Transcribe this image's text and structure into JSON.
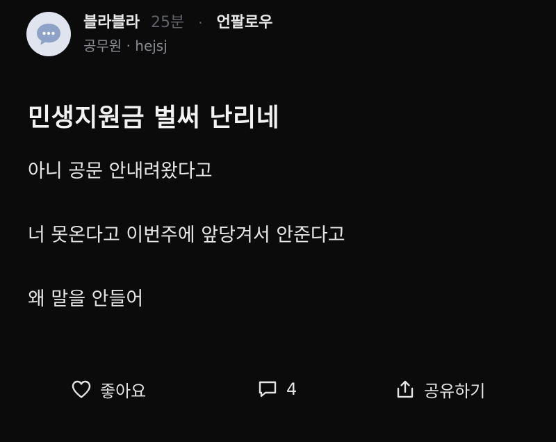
{
  "author": {
    "name": "블라블라",
    "time": "25분",
    "separator": "·",
    "unfollow_label": "언팔로우",
    "company_line": "공무원 · hejsj"
  },
  "post": {
    "title": "민생지원금 벌써 난리네",
    "paragraphs": [
      "아니 공문 안내려왔다고",
      "너 못온다고 이번주에 앞당겨서 안준다고",
      "왜 말을 안들어"
    ]
  },
  "actions": {
    "like_label": "좋아요",
    "comment_count": "4",
    "share_label": "공유하기"
  },
  "icons": {
    "avatar": "chat-bubble-icon",
    "like": "heart-icon",
    "comment": "comment-icon",
    "share": "share-icon"
  },
  "colors": {
    "background": "#0b0b0c",
    "avatar_bg": "#dfe4ee",
    "avatar_bubble": "#8ea1c6",
    "muted": "#5f6166",
    "text": "#e6e6e6"
  }
}
